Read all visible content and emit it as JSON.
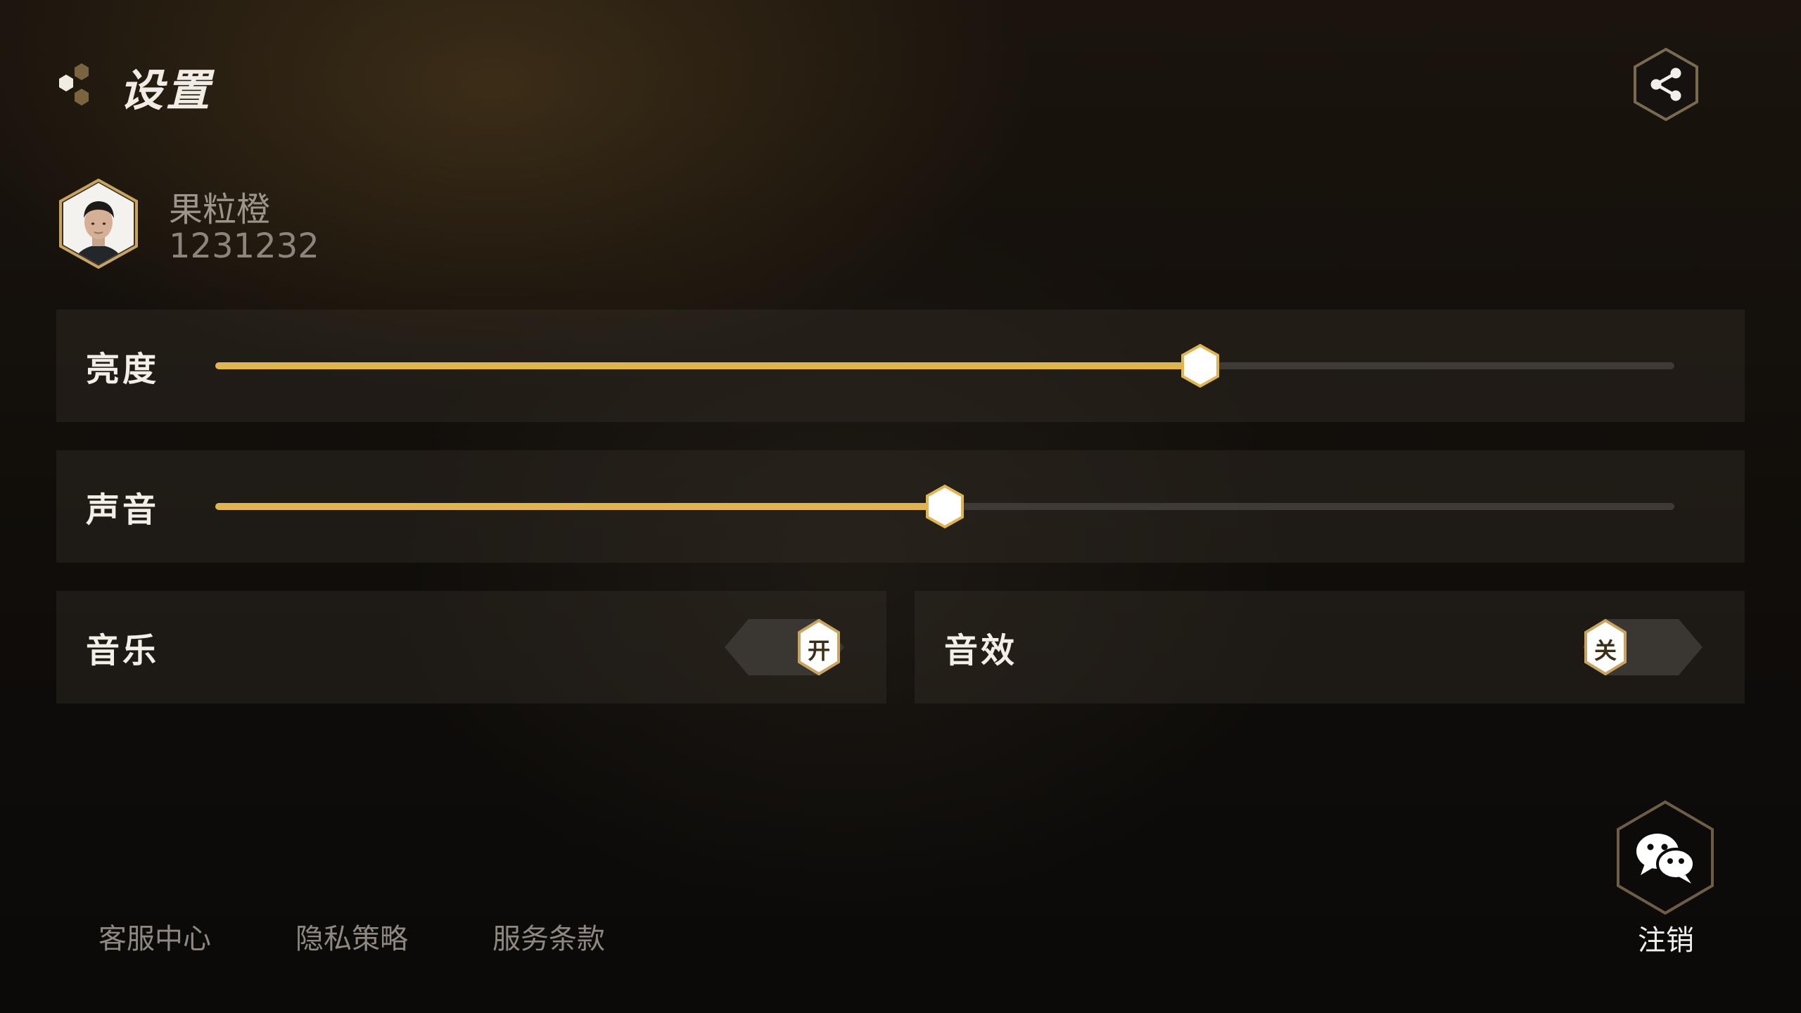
{
  "header": {
    "title": "设置",
    "logo_icon": "hexagon-cluster-logo",
    "share_icon": "share-icon"
  },
  "profile": {
    "name": "果粒橙",
    "id": "1231232"
  },
  "settings": {
    "brightness": {
      "label": "亮度",
      "value_fraction": 0.675
    },
    "volume": {
      "label": "声音",
      "value_fraction": 0.5
    },
    "music": {
      "label": "音乐",
      "state_text": "开",
      "on": true
    },
    "sound_effects": {
      "label": "音效",
      "state_text": "关",
      "on": false
    }
  },
  "footer": {
    "links": [
      "客服中心",
      "隐私策略",
      "服务条款"
    ],
    "logout_label": "注销",
    "logout_icon": "wechat-icon"
  },
  "colors": {
    "accent": "#e0b44e",
    "accent_border": "#c9a461",
    "text_primary": "#f3efe7",
    "text_secondary": "#8e8880"
  }
}
